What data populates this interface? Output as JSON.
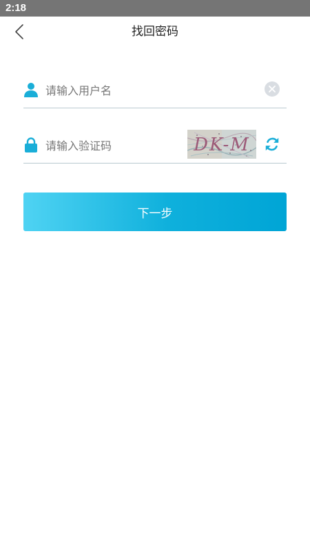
{
  "status_bar": {
    "time": "2:18"
  },
  "nav": {
    "back_icon": "chevron-left-icon",
    "title": "找回密码"
  },
  "form": {
    "username": {
      "icon": "user-icon",
      "placeholder": "请输入用户名",
      "value": "",
      "clear_icon": "clear-icon"
    },
    "captcha": {
      "icon": "lock-icon",
      "placeholder": "请输入验证码",
      "value": "",
      "captcha_text": "DK-M",
      "refresh_icon": "refresh-icon"
    }
  },
  "next_button": {
    "label": "下一步"
  },
  "colors": {
    "accent": "#1aaed8",
    "status_bar": "#757575",
    "divider": "#b9c9cf"
  }
}
